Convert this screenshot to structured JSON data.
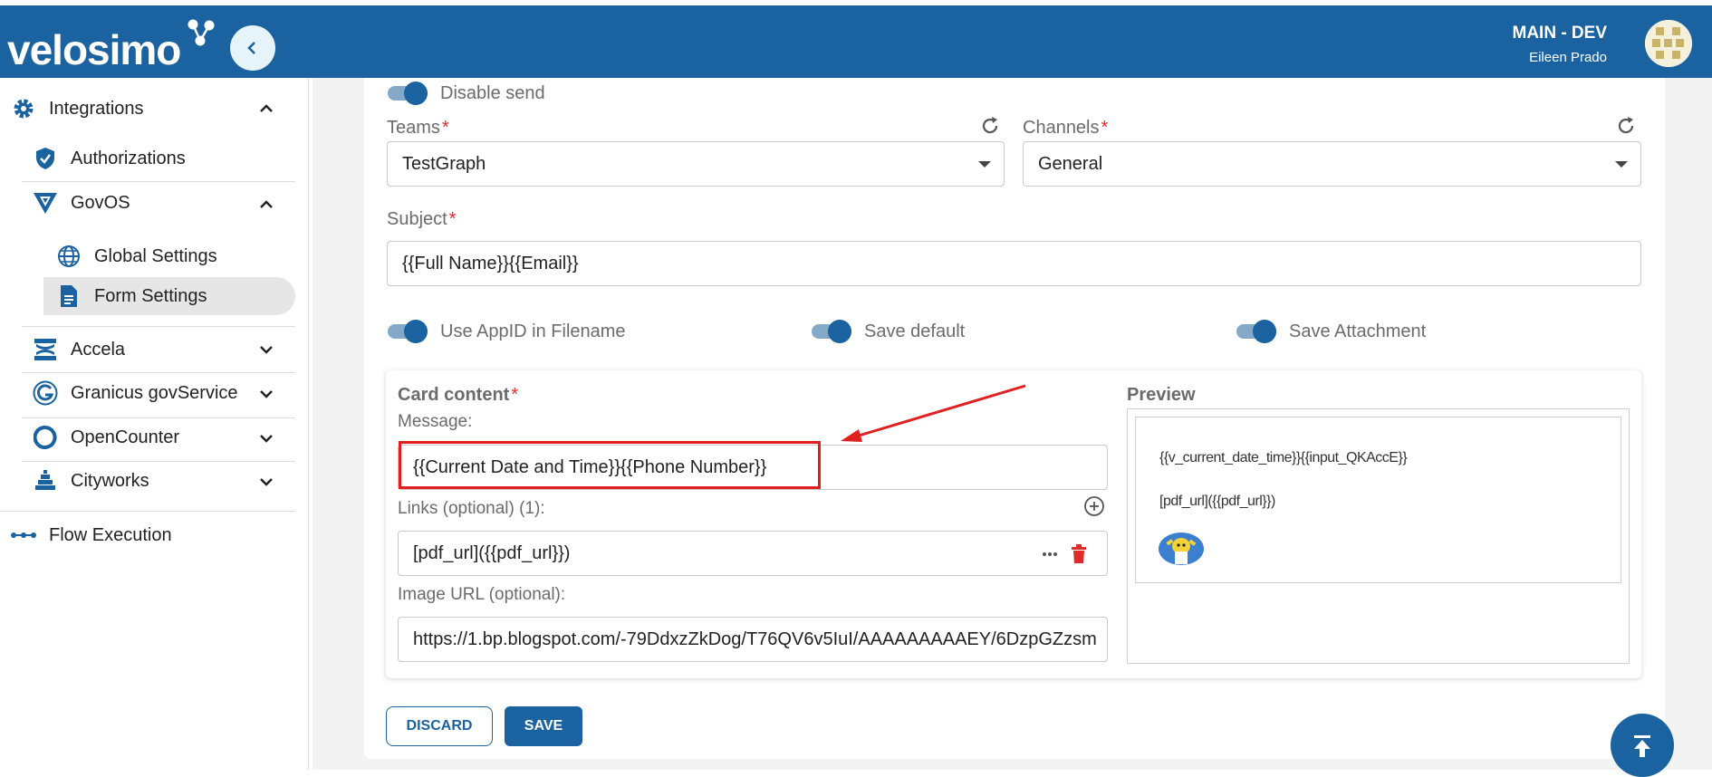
{
  "header": {
    "logo": "velosimo",
    "environment": "MAIN - DEV",
    "user_name": "Eileen Prado"
  },
  "sidebar": {
    "integrations": "Integrations",
    "authorizations": "Authorizations",
    "govos": "GovOS",
    "global_settings": "Global Settings",
    "form_settings": "Form Settings",
    "accela": "Accela",
    "granicus": "Granicus govService",
    "opencounter": "OpenCounter",
    "cityworks": "Cityworks",
    "flow_execution": "Flow Execution"
  },
  "form": {
    "disable_send": "Disable send",
    "teams_label": "Teams",
    "teams_value": "TestGraph",
    "channels_label": "Channels",
    "channels_value": "General",
    "subject_label": "Subject",
    "subject_value": "{{Full Name}}{{Email}}",
    "use_appid": "Use AppID in Filename",
    "save_default": "Save default",
    "save_attachment": "Save Attachment",
    "required_mark": "*"
  },
  "card": {
    "title": "Card content",
    "message_label": "Message:",
    "message_value": "{{Current Date and Time}}{{Phone Number}}",
    "links_label": "Links (optional) (1):",
    "link_value": "[pdf_url]({{pdf_url}})",
    "image_label": "Image URL (optional):",
    "image_value": "https://1.bp.blogspot.com/-79DdxzZkDog/T76QV6v5IuI/AAAAAAAAAEY/6DzpGZzsm",
    "preview_title": "Preview",
    "preview_line1": "{{v_current_date_time}}{{input_QKAccE}}",
    "preview_line2": "[pdf_url]({{pdf_url}})"
  },
  "actions": {
    "discard": "DISCARD",
    "save": "SAVE"
  },
  "colors": {
    "brand": "#1a62a0",
    "required": "#e02b2b",
    "annotation": "#e01f1f"
  }
}
